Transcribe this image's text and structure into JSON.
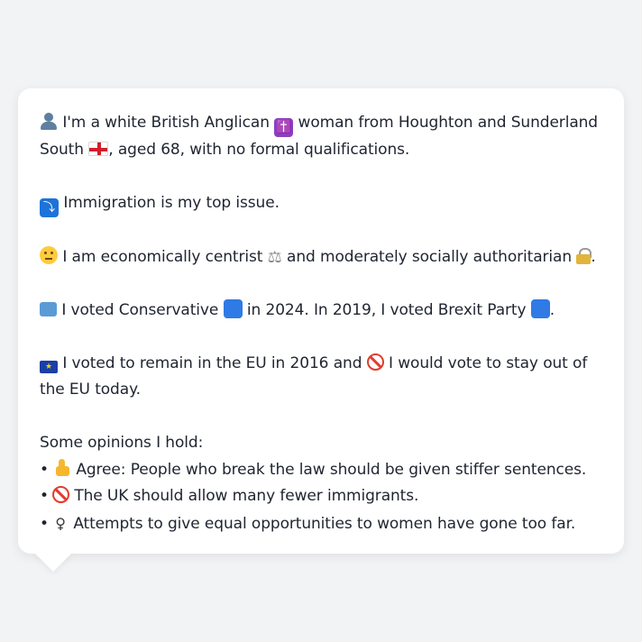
{
  "message": {
    "p1_text_a": "I'm a white British Anglican",
    "p1_text_b": "woman from Houghton and Sunderland South",
    "p1_text_c": ", aged 68, with no formal qualifications.",
    "p2_text": "Immigration is my top issue.",
    "p3_text_a": "I am economically centrist",
    "p3_text_b": "and moderately socially authoritarian",
    "p3_text_c": ".",
    "p4_text_a": "I voted Conservative",
    "p4_text_b": "in 2024. In 2019, I voted Brexit Party",
    "p4_text_c": ".",
    "p5_text_a": "I voted to remain in the EU in 2016 and",
    "p5_text_b": "I would vote to stay out of the EU today.",
    "opinions_heading": "Some opinions I hold:",
    "opinions": [
      {
        "bullet": "•",
        "text": "Agree: People who break the law should be given stiffer sentences."
      },
      {
        "bullet": "•",
        "text": "The UK should allow many fewer immigrants."
      },
      {
        "bullet": "•",
        "text": "Attempts to give equal opportunities to women have gone too far."
      }
    ]
  },
  "icons": {
    "person": "person-icon",
    "cross": "✝️",
    "england_flag": "england-flag-icon",
    "arrow": "⤵",
    "thinking": "thinking-face-icon",
    "scales": "⚖",
    "lock": "lock-icon",
    "ballot": "ballot-box-icon",
    "eu_flag": "★",
    "no_entry": "prohibited-icon",
    "thumbs_up": "thumbs-up-icon",
    "female": "♀"
  },
  "colors": {
    "conservative_blue": "#2f7ae5",
    "brexit_blue": "#2f7ae5",
    "prohibited_red": "#e23b2e"
  }
}
